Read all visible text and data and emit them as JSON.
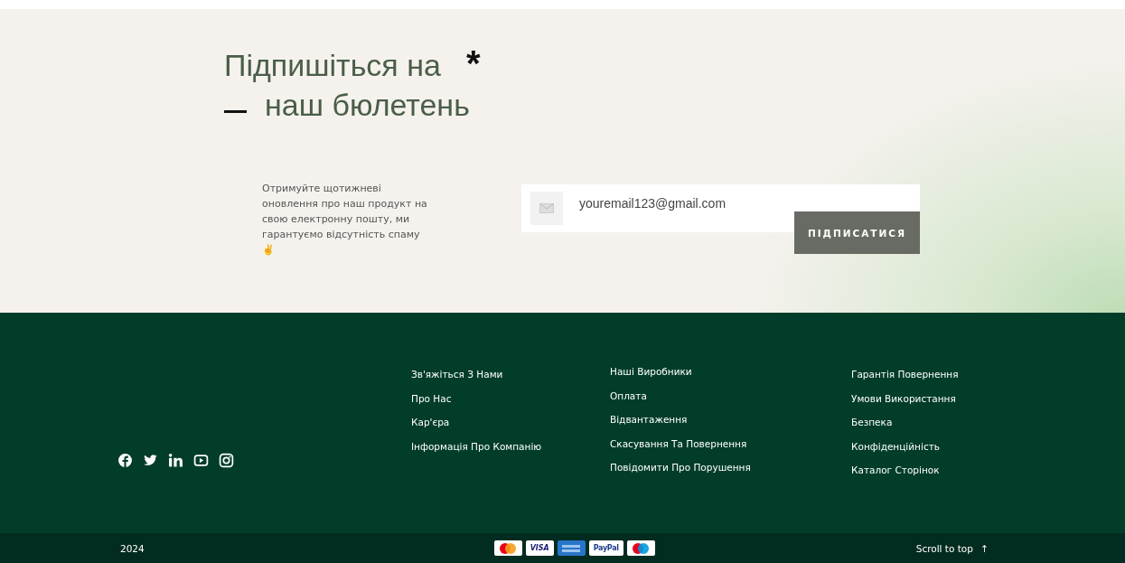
{
  "newsletter": {
    "title_line_1": "Підпишіться на",
    "title_line_2": "наш бюлетень",
    "decor_mark": "*",
    "description": "Отримуйте щотижневі оновлення про наш продукт на свою електронну пошту, ми гарантуємо відсутність спаму ✌️",
    "email_field": {
      "value": "youremail123@gmail.com"
    },
    "subscribe_button": "ПІДПИСАТИСЯ"
  },
  "footer": {
    "social_links": [
      {
        "kind": "facebook"
      },
      {
        "kind": "twitter"
      },
      {
        "kind": "linkedin"
      },
      {
        "kind": "youtube"
      },
      {
        "kind": "instagram"
      }
    ],
    "columns": [
      [
        "Зв'яжіться З Нами",
        "Про Нас",
        "Кар'єра",
        "Інформація Про Компанію"
      ],
      [
        "Наші Виробники",
        "Оплата",
        "Відвантаження",
        "Скасування Та Повернення",
        "Повідомити Про Порушення"
      ],
      [
        "Гарантія Повернення",
        "Умови Використання",
        "Безпека",
        "Конфіденційність",
        "Каталог Сторінок"
      ]
    ]
  },
  "bottom_bar": {
    "year": "2024",
    "payment_cards": [
      {
        "kind": "mastercard"
      },
      {
        "kind": "visa",
        "label": "VISA"
      },
      {
        "kind": "amex"
      },
      {
        "kind": "paypal",
        "label": "PayPal"
      },
      {
        "kind": "maestro"
      }
    ],
    "scroll_to_top": "Scroll to top",
    "scroll_arrow": "↑"
  }
}
